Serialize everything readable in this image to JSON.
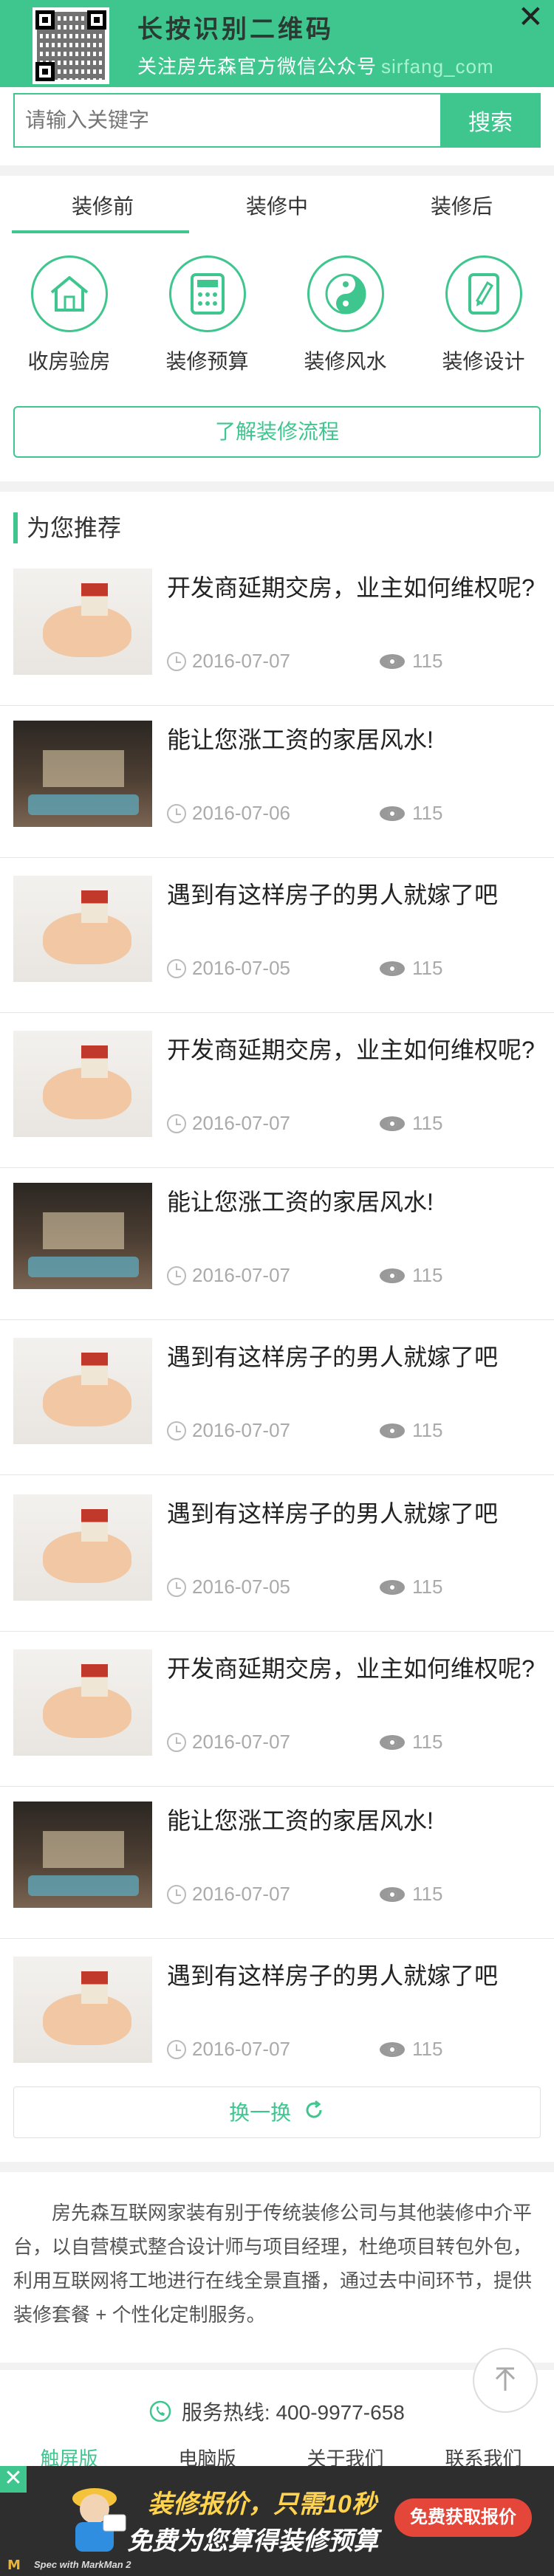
{
  "banner": {
    "title": "长按识别二维码",
    "subtitle": "关注房先森官方微信公众号",
    "site": "sirfang_com",
    "close": "✕"
  },
  "search": {
    "placeholder": "请输入关键字",
    "button": "搜索"
  },
  "tabs": [
    "装修前",
    "装修中",
    "装修后"
  ],
  "categories": [
    {
      "label": "收房验房",
      "icon": "house-icon"
    },
    {
      "label": "装修预算",
      "icon": "calculator-icon"
    },
    {
      "label": "装修风水",
      "icon": "yin-yang-icon"
    },
    {
      "label": "装修设计",
      "icon": "design-icon"
    }
  ],
  "process_button": "了解装修流程",
  "recommend": {
    "heading": "为您推荐",
    "articles": [
      {
        "title": "开发商延期交房，业主如何维权呢?",
        "date": "2016-07-07",
        "views": "115",
        "thumb": "hands"
      },
      {
        "title": "能让您涨工资的家居风水!",
        "date": "2016-07-06",
        "views": "115",
        "thumb": "room"
      },
      {
        "title": "遇到有这样房子的男人就嫁了吧",
        "date": "2016-07-05",
        "views": "115",
        "thumb": "hands"
      },
      {
        "title": "开发商延期交房，业主如何维权呢?",
        "date": "2016-07-07",
        "views": "115",
        "thumb": "hands"
      },
      {
        "title": "能让您涨工资的家居风水!",
        "date": "2016-07-07",
        "views": "115",
        "thumb": "room"
      },
      {
        "title": "遇到有这样房子的男人就嫁了吧",
        "date": "2016-07-07",
        "views": "115",
        "thumb": "hands"
      },
      {
        "title": "遇到有这样房子的男人就嫁了吧",
        "date": "2016-07-05",
        "views": "115",
        "thumb": "hands"
      },
      {
        "title": "开发商延期交房，业主如何维权呢?",
        "date": "2016-07-07",
        "views": "115",
        "thumb": "hands"
      },
      {
        "title": "能让您涨工资的家居风水!",
        "date": "2016-07-07",
        "views": "115",
        "thumb": "room"
      },
      {
        "title": "遇到有这样房子的男人就嫁了吧",
        "date": "2016-07-07",
        "views": "115",
        "thumb": "hands"
      }
    ],
    "refresh": "换一换"
  },
  "about": "房先森互联网家装有别于传统装修公司与其他装修中介平台，以自营模式整合设计师与项目经理，杜绝项目转包外包，利用互联网将工地进行在线全景直播，通过去中间环节，提供装修套餐 + 个性化定制服务。",
  "hotline": "服务热线: 400-9977-658",
  "footer_nav": [
    "触屏版",
    "电脑版",
    "关于我们",
    "联系我们"
  ],
  "promo": {
    "line1": "装修报价，只需10秒",
    "line2": "免费为您算得装修预算",
    "button": "免费获取报价",
    "close": "✕"
  },
  "markman": {
    "text": "Spec with MarkMan 2"
  },
  "colors": {
    "accent": "#3fc68f",
    "promo_button": "#e5463a",
    "promo_highlight": "#ffd34d"
  }
}
